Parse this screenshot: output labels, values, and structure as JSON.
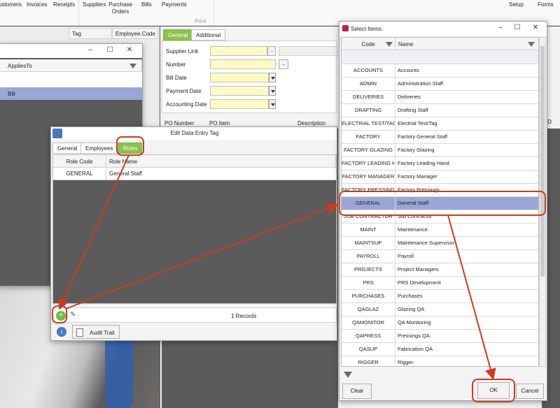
{
  "ribbon": {
    "items": [
      "ustomers",
      "Invoices",
      "Receipts",
      "Suppliers",
      "Purchase Orders",
      "Bills",
      "Payments"
    ],
    "group_label": "Print",
    "right_items": [
      "Setup",
      "Forms"
    ]
  },
  "bg_grid": {
    "col_tag": "Tag",
    "col_employee_code": "Employee.Code"
  },
  "applies_window": {
    "col_applies_to": "AppliesTo",
    "row_value": "Bill"
  },
  "bill_form": {
    "tabs": [
      "General",
      "Additional"
    ],
    "fields": [
      "Supplier Link",
      "Number",
      "Bill Date",
      "Payment Date",
      "Accounting Date"
    ],
    "ellipsis": "..",
    "po_columns": [
      "PO Number",
      "PO Item",
      "Description"
    ],
    "right_fragment": "ID"
  },
  "edit_tag": {
    "title": "Edit Data Entry Tag",
    "tabs": [
      "General",
      "Employees",
      "Roles"
    ],
    "columns": [
      "Role Code",
      "Role Name"
    ],
    "rows": [
      {
        "code": "GENERAL",
        "name": "General Staff"
      }
    ],
    "records": "1 Records",
    "audit_trail": "Audit Trail"
  },
  "select_items": {
    "title": "Select Items",
    "col_code": "Code",
    "col_name": "Name",
    "rows": [
      {
        "code": "ACCOUNTS",
        "name": "Accounts"
      },
      {
        "code": "ADMIN",
        "name": "Administration Staff"
      },
      {
        "code": "DELIVERIES",
        "name": "Deliveries"
      },
      {
        "code": "DRAFTING",
        "name": "Drafting Staff"
      },
      {
        "code": "ELECTRIAL TEST/TAG",
        "name": "Electrial Test/Tag"
      },
      {
        "code": "FACTORY",
        "name": "Factory General Staff"
      },
      {
        "code": "FACTORY GLAZING",
        "name": "Factory Glazing"
      },
      {
        "code": "FACTORY LEADING H",
        "name": "Factory Leading Hand"
      },
      {
        "code": "FACTORY MANAGER",
        "name": "Factory Manager"
      },
      {
        "code": "FACTORY PRESSINGS",
        "name": "Factory Pressings"
      },
      {
        "code": "GENERAL",
        "name": "General Staff"
      },
      {
        "code": "JOB CONTRACTOR",
        "name": "Job Contractor"
      },
      {
        "code": "MAINT",
        "name": "Maintenance"
      },
      {
        "code": "MAINTSUP",
        "name": "Maintenance Supervisor"
      },
      {
        "code": "PAYROLL",
        "name": "Payroll"
      },
      {
        "code": "PROJECTS",
        "name": "Project Managers"
      },
      {
        "code": "PRS",
        "name": "PRS Development"
      },
      {
        "code": "PURCHASES",
        "name": "Purchases"
      },
      {
        "code": "QAGLAZ",
        "name": "Glazing QA"
      },
      {
        "code": "QAMONITOR",
        "name": "QA Monitoring"
      },
      {
        "code": "QAPRESS",
        "name": "Pressings QA"
      },
      {
        "code": "QASUP",
        "name": "Fabrication QA"
      },
      {
        "code": "RIGGER",
        "name": "Rigger"
      }
    ],
    "selected_index": 10,
    "clear_label": "Clear",
    "ok_label": "OK",
    "cancel_label": "Cancel"
  },
  "colors": {
    "accent_green": "#8bc34a",
    "selection": "#9aa6d6",
    "annotation_red": "#cc3b1e",
    "input_yellow": "#fff9c4"
  }
}
